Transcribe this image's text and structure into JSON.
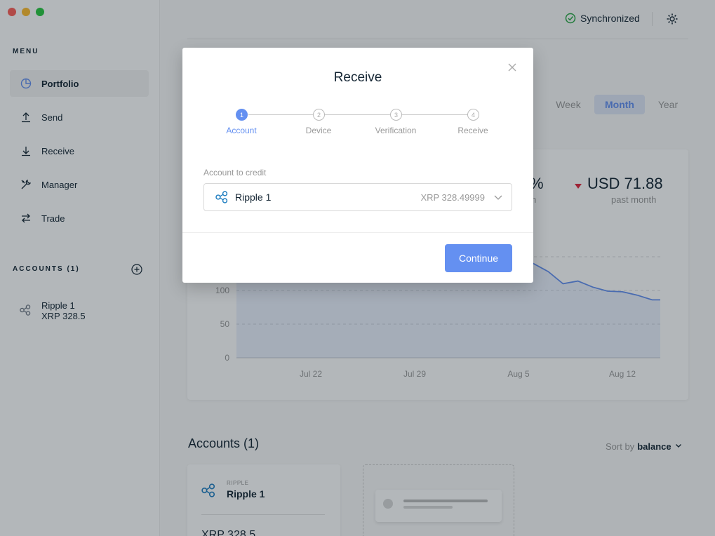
{
  "sidebar": {
    "menu_title": "MENU",
    "menu": [
      {
        "label": "Portfolio",
        "icon": "pie-chart-icon",
        "active": true
      },
      {
        "label": "Send",
        "icon": "upload-arrow-icon"
      },
      {
        "label": "Receive",
        "icon": "download-arrow-icon"
      },
      {
        "label": "Manager",
        "icon": "tools-icon"
      },
      {
        "label": "Trade",
        "icon": "swap-arrows-icon"
      }
    ],
    "accounts_title": "ACCOUNTS (1)",
    "accounts": [
      {
        "name": "Ripple 1",
        "balance": "XRP 328.5",
        "icon": "ripple-icon"
      }
    ]
  },
  "topbar": {
    "sync_status": "Synchronized",
    "settings_icon": "gear-icon"
  },
  "dashboard": {
    "ranges": [
      "Week",
      "Month",
      "Year"
    ],
    "active_range": "Month",
    "percent_fragment": "%",
    "percent_sub_fragment": "h",
    "change_value": "USD 71.88",
    "change_label": "past month",
    "accounts_title": "Accounts (1)",
    "sort_label": "Sort by",
    "sort_value": "balance",
    "account_card": {
      "currency": "RIPPLE",
      "name": "Ripple 1",
      "balance": "XRP 328.5"
    }
  },
  "chart_data": {
    "type": "area",
    "x_ticks": [
      "Jul 22",
      "Jul 29",
      "Aug 5",
      "Aug 12"
    ],
    "y_ticks": [
      0,
      50,
      100
    ],
    "visible_tail": [
      {
        "x": "Aug 5",
        "y": 145
      },
      {
        "x": "Aug 6",
        "y": 140
      },
      {
        "x": "Aug 7",
        "y": 128
      },
      {
        "x": "Aug 8",
        "y": 110
      },
      {
        "x": "Aug 9",
        "y": 114
      },
      {
        "x": "Aug 10",
        "y": 105
      },
      {
        "x": "Aug 11",
        "y": 99
      },
      {
        "x": "Aug 12",
        "y": 98
      },
      {
        "x": "Aug 13",
        "y": 93
      },
      {
        "x": "Aug 14",
        "y": 86
      }
    ],
    "color": "#6490f1"
  },
  "modal": {
    "title": "Receive",
    "steps": [
      {
        "num": "1",
        "label": "Account",
        "active": true
      },
      {
        "num": "2",
        "label": "Device"
      },
      {
        "num": "3",
        "label": "Verification"
      },
      {
        "num": "4",
        "label": "Receive"
      }
    ],
    "field_label": "Account to credit",
    "selected_account": "Ripple 1",
    "selected_balance": "XRP 328.49999",
    "continue_label": "Continue"
  },
  "colors": {
    "accent": "#6490f1",
    "success": "#29a745",
    "negative": "#e0263d"
  }
}
